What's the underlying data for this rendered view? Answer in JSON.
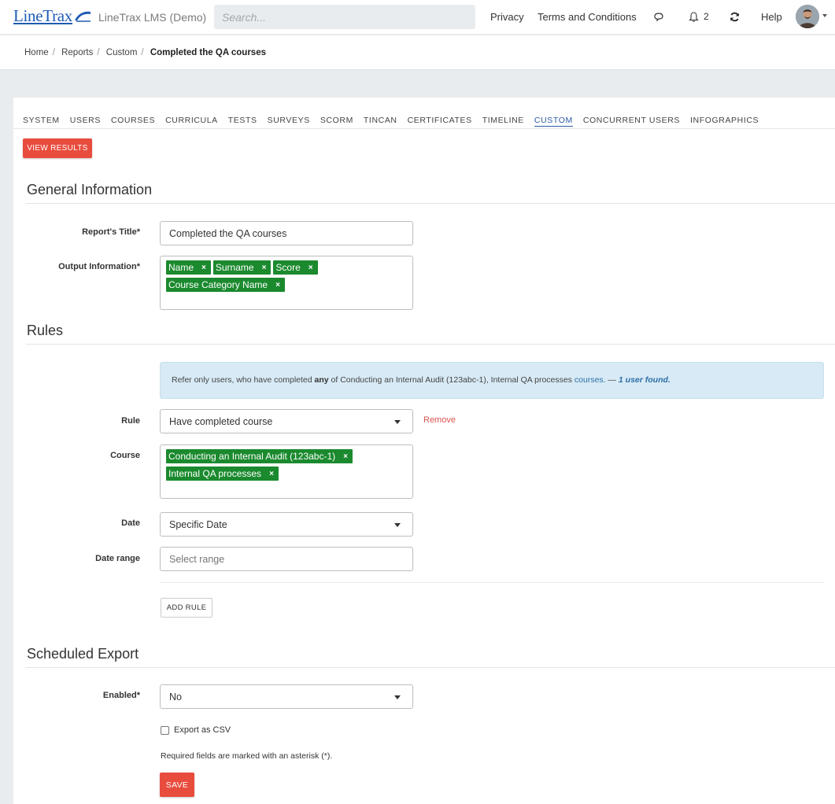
{
  "header": {
    "logo_text": "LineTrax",
    "app_name": "LineTrax LMS (Demo)",
    "search_placeholder": "Search...",
    "links": {
      "privacy": "Privacy",
      "terms": "Terms and Conditions",
      "help": "Help"
    },
    "notification_count": "2",
    "icons": [
      "chat-icon",
      "bell-icon",
      "refresh-icon",
      "avatar",
      "chevron-down-icon"
    ]
  },
  "breadcrumb": {
    "items": [
      "Home",
      "Reports",
      "Custom"
    ],
    "current": "Completed the QA courses"
  },
  "tabs": [
    {
      "label": "SYSTEM",
      "active": false
    },
    {
      "label": "USERS",
      "active": false
    },
    {
      "label": "COURSES",
      "active": false
    },
    {
      "label": "CURRICULA",
      "active": false
    },
    {
      "label": "TESTS",
      "active": false
    },
    {
      "label": "SURVEYS",
      "active": false
    },
    {
      "label": "SCORM",
      "active": false
    },
    {
      "label": "TINCAN",
      "active": false
    },
    {
      "label": "CERTIFICATES",
      "active": false
    },
    {
      "label": "TIMELINE",
      "active": false
    },
    {
      "label": "CUSTOM",
      "active": true
    },
    {
      "label": "CONCURRENT USERS",
      "active": false
    },
    {
      "label": "INFOGRAPHICS",
      "active": false
    }
  ],
  "view_results_label": "VIEW RESULTS",
  "general": {
    "title": "General Information",
    "report_title_label": "Report's Title*",
    "report_title_value": "Completed the QA courses",
    "output_label": "Output Information*",
    "output_tags": [
      "Name",
      "Surname",
      "Score",
      "Course Category Name"
    ]
  },
  "rules": {
    "title": "Rules",
    "alert": {
      "prefix": "Refer only users, who have completed ",
      "any": "any",
      "middle": " of Conducting an Internal Audit (123abc-1), Internal QA processes ",
      "courses": "courses.",
      "dash": " — ",
      "found": "1 user found."
    },
    "rule_label": "Rule",
    "rule_value": "Have completed course",
    "remove_label": "Remove",
    "course_label": "Course",
    "course_tags": [
      "Conducting an Internal Audit (123abc-1)",
      "Internal QA processes"
    ],
    "date_label": "Date",
    "date_value": "Specific Date",
    "date_range_label": "Date range",
    "date_range_placeholder": "Select range",
    "add_rule_label": "ADD RULE"
  },
  "export": {
    "title": "Scheduled Export",
    "enabled_label": "Enabled*",
    "enabled_value": "No",
    "csv_label": "Export as CSV",
    "required_note": "Required fields are marked with an asterisk (*).",
    "save_label": "SAVE"
  },
  "colors": {
    "accent_red": "#e84c3d",
    "tag_green": "#1b8a2e",
    "active_tab": "#2d5aa7",
    "alert_bg": "#d7eaf5"
  }
}
